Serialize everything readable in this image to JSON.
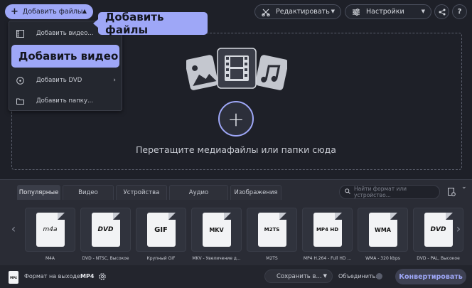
{
  "toolbar": {
    "add_files_label": "Добавить файлы",
    "edit_label": "Редактировать",
    "settings_label": "Настройки",
    "help_label": "?"
  },
  "callouts": {
    "add_files": "Добавить файлы",
    "add_video": "Добавить видео"
  },
  "add_menu": {
    "items": [
      {
        "label": "Добавить видео..."
      },
      {
        "label": "Добавить DVD"
      },
      {
        "label": "Добавить папку..."
      }
    ]
  },
  "dropzone": {
    "text": "Перетащите медиафайлы или папки сюда"
  },
  "format_panel": {
    "tabs": [
      {
        "label": "Популярные",
        "active": true
      },
      {
        "label": "Видео"
      },
      {
        "label": "Устройства"
      },
      {
        "label": "Аудио"
      },
      {
        "label": "Изображения"
      }
    ],
    "search_placeholder": "Найти формат или устройство...",
    "formats": [
      {
        "icon": "m4a-icon",
        "badge": "m4a",
        "caption": "M4A"
      },
      {
        "icon": "dvd-ntsc-icon",
        "badge": "DVD",
        "caption": "DVD - NTSC, Высокое"
      },
      {
        "icon": "gif-icon",
        "badge": "GIF",
        "caption": "Крупный GIF"
      },
      {
        "icon": "mkv-icon",
        "badge": "MKV",
        "caption": "MKV - Увеличение д..."
      },
      {
        "icon": "bluray-icon",
        "badge": "M2TS",
        "caption": "M2TS"
      },
      {
        "icon": "mp4-hd-icon",
        "badge": "MP4 HD",
        "caption": "MP4 H.264 - Full HD ..."
      },
      {
        "icon": "windows-icon",
        "badge": "WMA",
        "caption": "WMA - 320 kbps"
      },
      {
        "icon": "dvd-pal-icon",
        "badge": "DVD",
        "caption": "DVD - PAL, Высокое"
      }
    ]
  },
  "statusbar": {
    "output_format_label": "Формат на выходе:",
    "output_format_value": "MP4",
    "save_label": "Сохранить в...",
    "merge_label": "Объединить:",
    "convert_label": "Конвертировать"
  },
  "colors": {
    "accent": "#9ea7f7",
    "background": "#1e2028",
    "panel": "#2a2c35"
  }
}
